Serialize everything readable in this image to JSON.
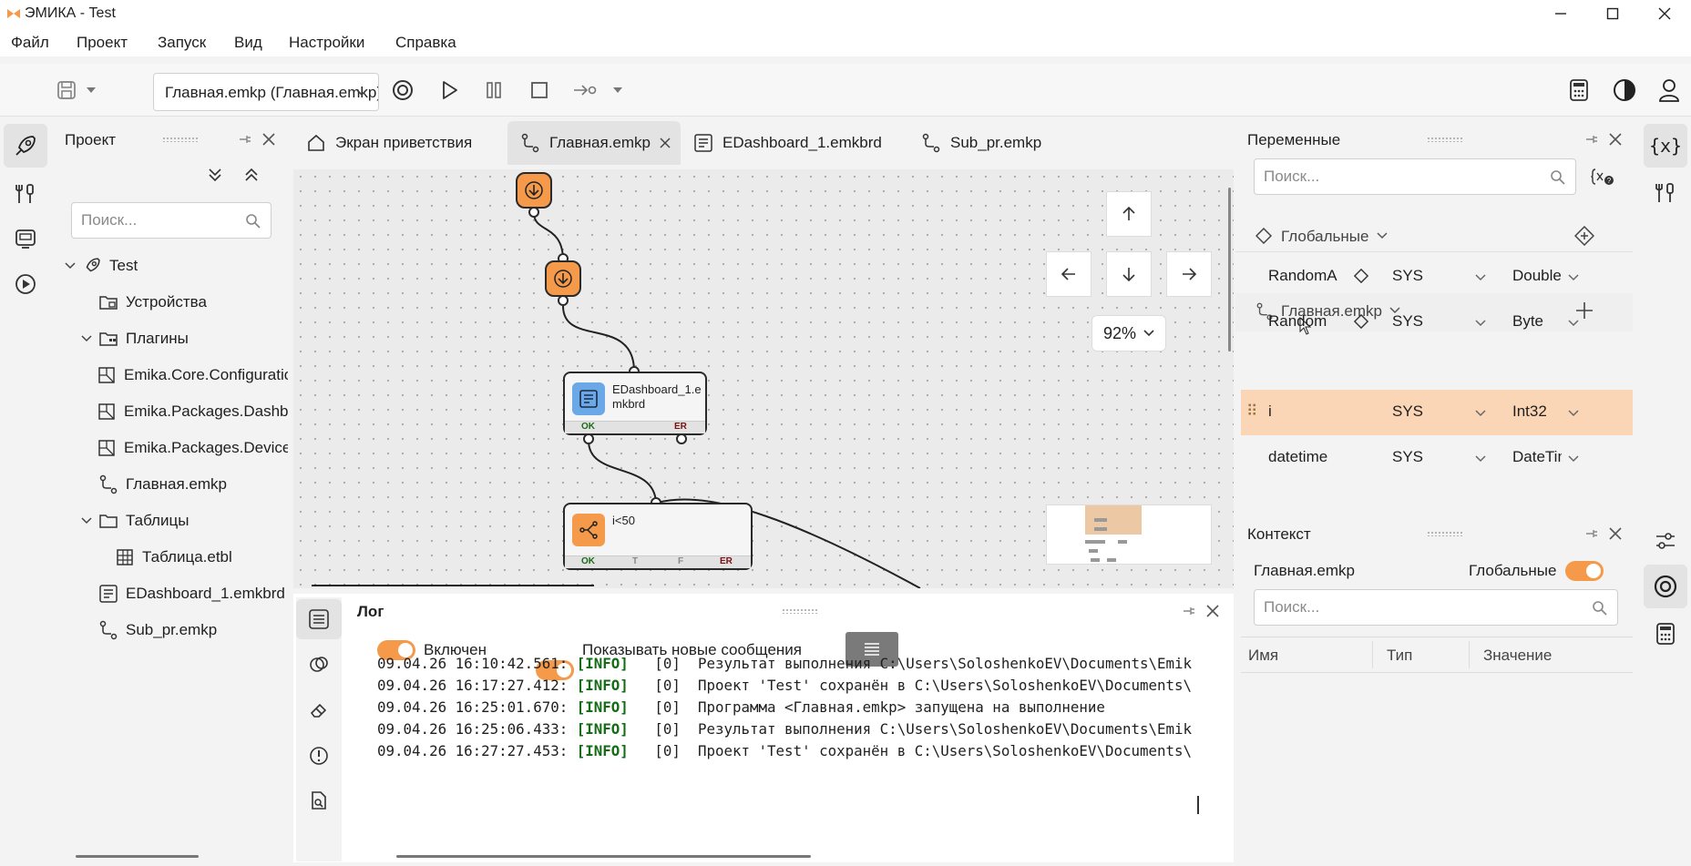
{
  "window": {
    "title": "ЭМИКА - Test"
  },
  "menu": {
    "items": [
      "Файл",
      "Проект",
      "Запуск",
      "Вид",
      "Настройки",
      "Справка"
    ]
  },
  "toolbar": {
    "combo_value": "Главная.emkp (Главная.emkp)"
  },
  "project_panel": {
    "title": "Проект",
    "search_placeholder": "Поиск...",
    "tree": [
      {
        "label": "Test",
        "icon": "rocket-icon",
        "indent": 0,
        "expander": "open"
      },
      {
        "label": "Устройства",
        "icon": "devices-folder-icon",
        "indent": 1,
        "expander": "none"
      },
      {
        "label": "Плагины",
        "icon": "plugins-folder-icon",
        "indent": 1,
        "expander": "open"
      },
      {
        "label": "Emika.Core.Configuration",
        "icon": "package-icon",
        "indent": 2,
        "expander": "none"
      },
      {
        "label": "Emika.Packages.Dashboard",
        "icon": "package-icon",
        "indent": 2,
        "expander": "none"
      },
      {
        "label": "Emika.Packages.Devices",
        "icon": "package-icon",
        "indent": 2,
        "expander": "none"
      },
      {
        "label": "Главная.emkp",
        "icon": "flow-icon",
        "indent": 1,
        "expander": "none"
      },
      {
        "label": "Таблицы",
        "icon": "folder-icon",
        "indent": 1,
        "expander": "open"
      },
      {
        "label": "Таблица.etbl",
        "icon": "table-icon",
        "indent": 2,
        "expander": "none"
      },
      {
        "label": "EDashboard_1.emkbrd",
        "icon": "dashboard-icon",
        "indent": 1,
        "expander": "none"
      },
      {
        "label": "Sub_pr.emkp",
        "icon": "flow-icon",
        "indent": 1,
        "expander": "none"
      }
    ]
  },
  "tabs": [
    {
      "label": "Экран приветствия",
      "icon": "home-icon",
      "active": false
    },
    {
      "label": "Главная.emkp",
      "icon": "flow-icon",
      "active": true
    },
    {
      "label": "EDashboard_1.emkbrd",
      "icon": "dashboard-icon",
      "active": false
    },
    {
      "label": "Sub_pr.emkp",
      "icon": "flow-icon",
      "active": false
    }
  ],
  "canvas": {
    "zoom": "92%",
    "block_dashboard": {
      "label": "EDashboard_1.emkbrd",
      "ports": [
        "OK",
        "ER"
      ]
    },
    "block_condition": {
      "label": "i<50",
      "ports": [
        "OK",
        "T",
        "F",
        "ER"
      ]
    }
  },
  "log_panel": {
    "title": "Лог",
    "toggle_enabled_label": "Включен",
    "toggle_new_label": "Показывать новые сообщения",
    "lines": [
      {
        "ts": "09.04.26 16:10:42.561:",
        "level": "[INFO]",
        "code": "[0]",
        "msg": "Результат выполнения C:\\Users\\SoloshenkoEV\\Documents\\Emik"
      },
      {
        "ts": "09.04.26 16:17:27.412:",
        "level": "[INFO]",
        "code": "[0]",
        "msg": "Проект 'Test' сохранён в C:\\Users\\SoloshenkoEV\\Documents\\"
      },
      {
        "ts": "09.04.26 16:25:01.670:",
        "level": "[INFO]",
        "code": "[0]",
        "msg": "Программа <Главная.emkp> запущена на выполнение"
      },
      {
        "ts": "09.04.26 16:25:06.433:",
        "level": "[INFO]",
        "code": "[0]",
        "msg": "Результат выполнения C:\\Users\\SoloshenkoEV\\Documents\\Emik"
      },
      {
        "ts": "09.04.26 16:27:27.453:",
        "level": "[INFO]",
        "code": "[0]",
        "msg": "Проект 'Test' сохранён в C:\\Users\\SoloshenkoEV\\Documents\\"
      }
    ]
  },
  "variables_panel": {
    "title": "Переменные",
    "search_placeholder": "Поиск...",
    "global_group": "Глобальные",
    "global_vars": [
      {
        "name": "RandomA",
        "scope": "SYS",
        "type": "Double"
      },
      {
        "name": "Random",
        "scope": "SYS",
        "type": "Byte"
      }
    ],
    "local_group": "Главная.emkp",
    "local_vars": [
      {
        "name": "i",
        "scope": "SYS",
        "type": "Int32",
        "selected": true
      },
      {
        "name": "datetime",
        "scope": "SYS",
        "type": "DateTime",
        "selected": false
      }
    ]
  },
  "context_panel": {
    "title": "Контекст",
    "program": "Главная.emkp",
    "globals_label": "Глобальные",
    "search_placeholder": "Поиск...",
    "columns": [
      "Имя",
      "Тип",
      "Значение"
    ]
  },
  "colors": {
    "accent": "#f59a4a",
    "selected_row": "#fbd6b6",
    "canvas_bg": "#ebebeb"
  }
}
